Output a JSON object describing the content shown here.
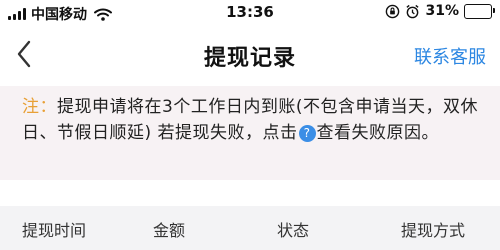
{
  "status_bar": {
    "carrier": "中国移动",
    "time": "13:36",
    "battery_percent": "31%",
    "battery_level": 0.31,
    "battery_color": "#2ecc40"
  },
  "nav": {
    "back_icon": "chevron-left-icon",
    "title": "提现记录",
    "action": "联系客服",
    "action_color": "#2d87e2"
  },
  "notice": {
    "prefix": "注：",
    "text_before_icon": "提现申请将在3个工作日内到账(不包含申请当天，双休日、节假日顺延)  若提现失败，点击",
    "help_icon": "?",
    "text_after_icon": "查看失败原因。",
    "prefix_color": "#e8a036"
  },
  "table": {
    "columns": [
      "提现时间",
      "金额",
      "状态",
      "提现方式"
    ]
  }
}
